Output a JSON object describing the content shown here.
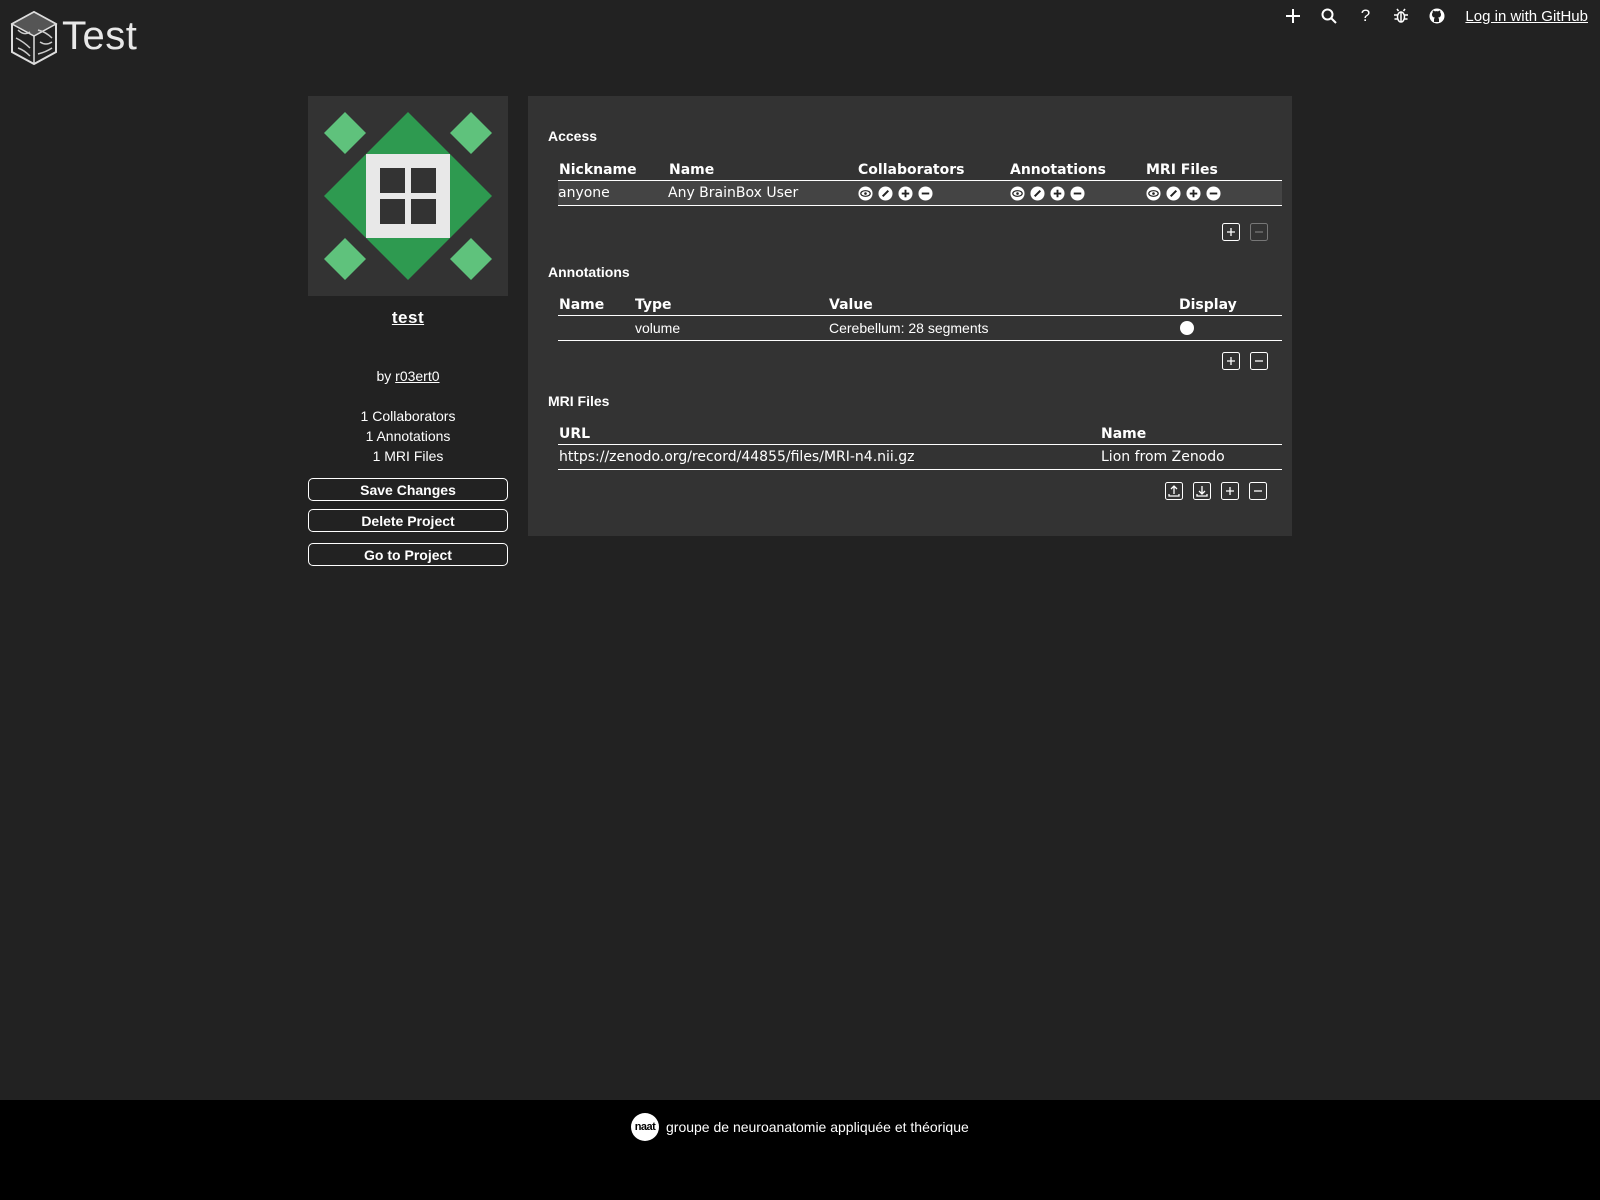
{
  "header": {
    "app_title": "Test",
    "nav_icons": [
      "plus-icon",
      "search-icon",
      "help-icon",
      "bug-icon",
      "github-icon"
    ],
    "help_glyph": "?",
    "login_label": "Log in with GitHub"
  },
  "project": {
    "name": "test",
    "by_prefix": "by",
    "owner": "r03ert0",
    "stats": {
      "collaborators": "1 Collaborators",
      "annotations": "1 Annotations",
      "mri_files": "1 MRI Files"
    },
    "buttons": {
      "save": "Save Changes",
      "delete": "Delete Project",
      "goto": "Go to Project"
    }
  },
  "access": {
    "title": "Access",
    "columns": [
      "Nickname",
      "Name",
      "Collaborators",
      "Annotations",
      "MRI Files"
    ],
    "rows": [
      {
        "nickname": "anyone",
        "name": "Any BrainBox User",
        "permission_icons": [
          "view-icon",
          "edit-icon",
          "add-icon",
          "remove-icon"
        ]
      }
    ]
  },
  "annotations": {
    "title": "Annotations",
    "columns": [
      "Name",
      "Type",
      "Value",
      "Display"
    ],
    "rows": [
      {
        "name": "",
        "type": "volume",
        "value": "Cerebellum: 28 segments",
        "display": true
      }
    ]
  },
  "mri_files": {
    "title": "MRI Files",
    "columns": [
      "URL",
      "Name"
    ],
    "rows": [
      {
        "url": "https://zenodo.org/record/44855/files/MRI-n4.nii.gz",
        "name": "Lion from Zenodo"
      }
    ]
  },
  "footer": {
    "logo_text": "naat",
    "label": "groupe de neuroanatomie appliquée et théorique"
  },
  "colors": {
    "background": "#222222",
    "panel": "#333333",
    "identicon_dark": "#2e9a50",
    "identicon_light": "#5fc27c",
    "footer": "#000000"
  }
}
